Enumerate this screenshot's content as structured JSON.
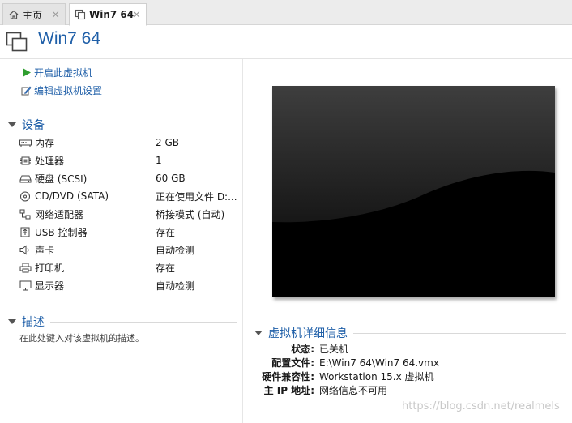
{
  "tabs": [
    {
      "label": "主页",
      "close": "×"
    },
    {
      "label": "Win7 64",
      "close": "×"
    }
  ],
  "vm_title": "Win7 64",
  "actions": {
    "power_on": "开启此虚拟机",
    "edit_settings": "编辑虚拟机设置"
  },
  "devices": {
    "title": "设备",
    "items": [
      {
        "name": "内存",
        "value": "2 GB",
        "icon": "memory-icon"
      },
      {
        "name": "处理器",
        "value": "1",
        "icon": "cpu-icon"
      },
      {
        "name": "硬盘 (SCSI)",
        "value": "60 GB",
        "icon": "hard-disk-icon"
      },
      {
        "name": "CD/DVD (SATA)",
        "value": "正在使用文件 D:...",
        "icon": "cd-dvd-icon"
      },
      {
        "name": "网络适配器",
        "value": "桥接模式 (自动)",
        "icon": "network-adapter-icon"
      },
      {
        "name": "USB 控制器",
        "value": "存在",
        "icon": "usb-icon"
      },
      {
        "name": "声卡",
        "value": "自动检测",
        "icon": "sound-card-icon"
      },
      {
        "name": "打印机",
        "value": "存在",
        "icon": "printer-icon"
      },
      {
        "name": "显示器",
        "value": "自动检测",
        "icon": "display-icon"
      }
    ]
  },
  "description": {
    "title": "描述",
    "placeholder": "在此处键入对该虚拟机的描述。"
  },
  "details": {
    "title": "虚拟机详细信息",
    "rows": [
      {
        "key": "状态:",
        "value": "已关机"
      },
      {
        "key": "配置文件:",
        "value": "E:\\Win7 64\\Win7 64.vmx"
      },
      {
        "key": "硬件兼容性:",
        "value": "Workstation 15.x 虚拟机"
      },
      {
        "key": "主 IP 地址:",
        "value": "网络信息不可用"
      }
    ]
  },
  "watermark": "https://blog.csdn.net/realmels",
  "colors": {
    "accent": "#1f5fa8",
    "power_green": "#2f9e2f"
  }
}
